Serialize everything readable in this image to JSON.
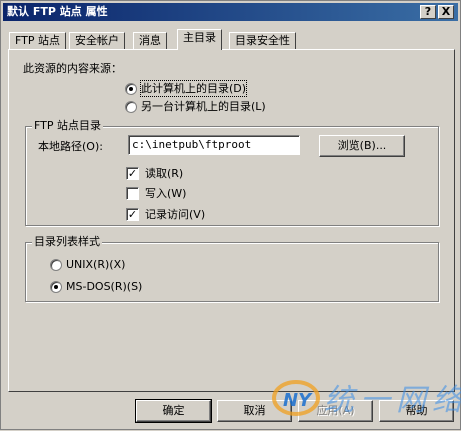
{
  "window": {
    "title": "默认 FTP 站点 属性",
    "help_button": "?",
    "close_button": "X"
  },
  "tabs": [
    {
      "label": "FTP 站点"
    },
    {
      "label": "安全帐户"
    },
    {
      "label": "消息"
    },
    {
      "label": "主目录"
    },
    {
      "label": "目录安全性"
    }
  ],
  "content_source": {
    "heading": "此资源的内容来源：",
    "options": [
      {
        "label": "此计算机上的目录(D)",
        "selected": true
      },
      {
        "label": "另一台计算机上的目录(L)",
        "selected": false
      }
    ]
  },
  "ftp_dir": {
    "group_title": "FTP 站点目录",
    "path_label": "本地路径(O):",
    "path_value": "c:\\inetpub\\ftproot",
    "browse_label": "浏览(B)...",
    "checks": [
      {
        "label": "读取(R)",
        "checked": true
      },
      {
        "label": "写入(W)",
        "checked": false
      },
      {
        "label": "记录访问(V)",
        "checked": true
      }
    ]
  },
  "listing_style": {
    "group_title": "目录列表样式",
    "options": [
      {
        "label": "UNIX(R)(X)",
        "selected": false
      },
      {
        "label": "MS-DOS(R)(S)",
        "selected": true
      }
    ]
  },
  "buttons": {
    "ok": "确定",
    "cancel": "取消",
    "apply": "应用(A)",
    "help": "帮助"
  },
  "watermark": {
    "logo": "NY",
    "text": "统一网络"
  },
  "colors": {
    "face": "#d4d0c8",
    "title_from": "#0a246a",
    "title_to": "#3a6ea5"
  }
}
